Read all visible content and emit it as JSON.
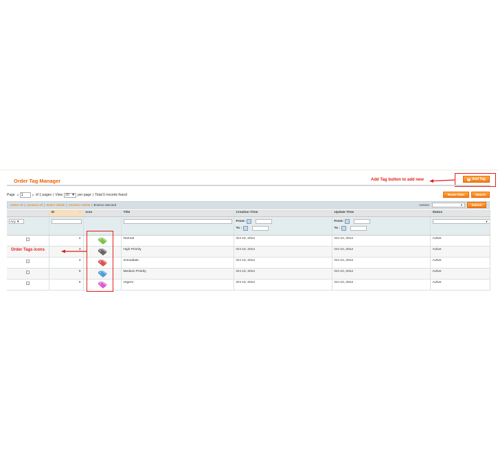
{
  "header": {
    "title": "Order Tag Manager",
    "add_tag_label": "Add Tag"
  },
  "annotations": {
    "add_tag_note": "Add Tag button to add new",
    "icons_note": "Order Tags icons"
  },
  "pager": {
    "page_label": "Page",
    "page_value": "1",
    "of_pages": "of 1 pages",
    "sep1": "|",
    "view_label": "View",
    "per_page_value": "20",
    "per_page_label": "per page",
    "sep2": "|",
    "total_text": "Total 5 records found"
  },
  "buttons": {
    "reset_filter": "Reset Filter",
    "search": "Search",
    "submit": "Submit"
  },
  "massaction": {
    "select_all": "Select All",
    "unselect_all": "Unselect All",
    "select_visible": "Select Visible",
    "unselect_visible": "Unselect Visible",
    "selected_count": "0",
    "selected_suffix": "items selected",
    "actions_label": "Actions"
  },
  "columns": {
    "id": "ID",
    "icon": "Icon",
    "title": "Title",
    "creation": "Creation Time",
    "update": "Update Time",
    "status": "Status"
  },
  "filters": {
    "any": "Any",
    "from": "From:",
    "to": "To :"
  },
  "rows": [
    {
      "id": "2",
      "icon_color": "#7fc24a",
      "title": "Normal",
      "created": "Oct 10, 2014",
      "updated": "Oct 10, 2014",
      "status": "Active"
    },
    {
      "id": "3",
      "icon_color": "#666666",
      "title": "High Priority",
      "created": "Oct 10, 2014",
      "updated": "Oct 10, 2014",
      "status": "Active"
    },
    {
      "id": "4",
      "icon_color": "#d9534f",
      "title": "Immediate",
      "created": "Oct 10, 2014",
      "updated": "Oct 10, 2014",
      "status": "Active"
    },
    {
      "id": "5",
      "icon_color": "#4a9fd8",
      "title": "Medium Priority",
      "created": "Oct 10, 2014",
      "updated": "Oct 10, 2014",
      "status": "Active"
    },
    {
      "id": "6",
      "icon_color": "#e05ad0",
      "title": "Urgent",
      "created": "Oct 10, 2014",
      "updated": "Oct 10, 2014",
      "status": "Active"
    }
  ],
  "colors": {
    "accent": "#eb5e00",
    "annotation": "#e41b17"
  }
}
